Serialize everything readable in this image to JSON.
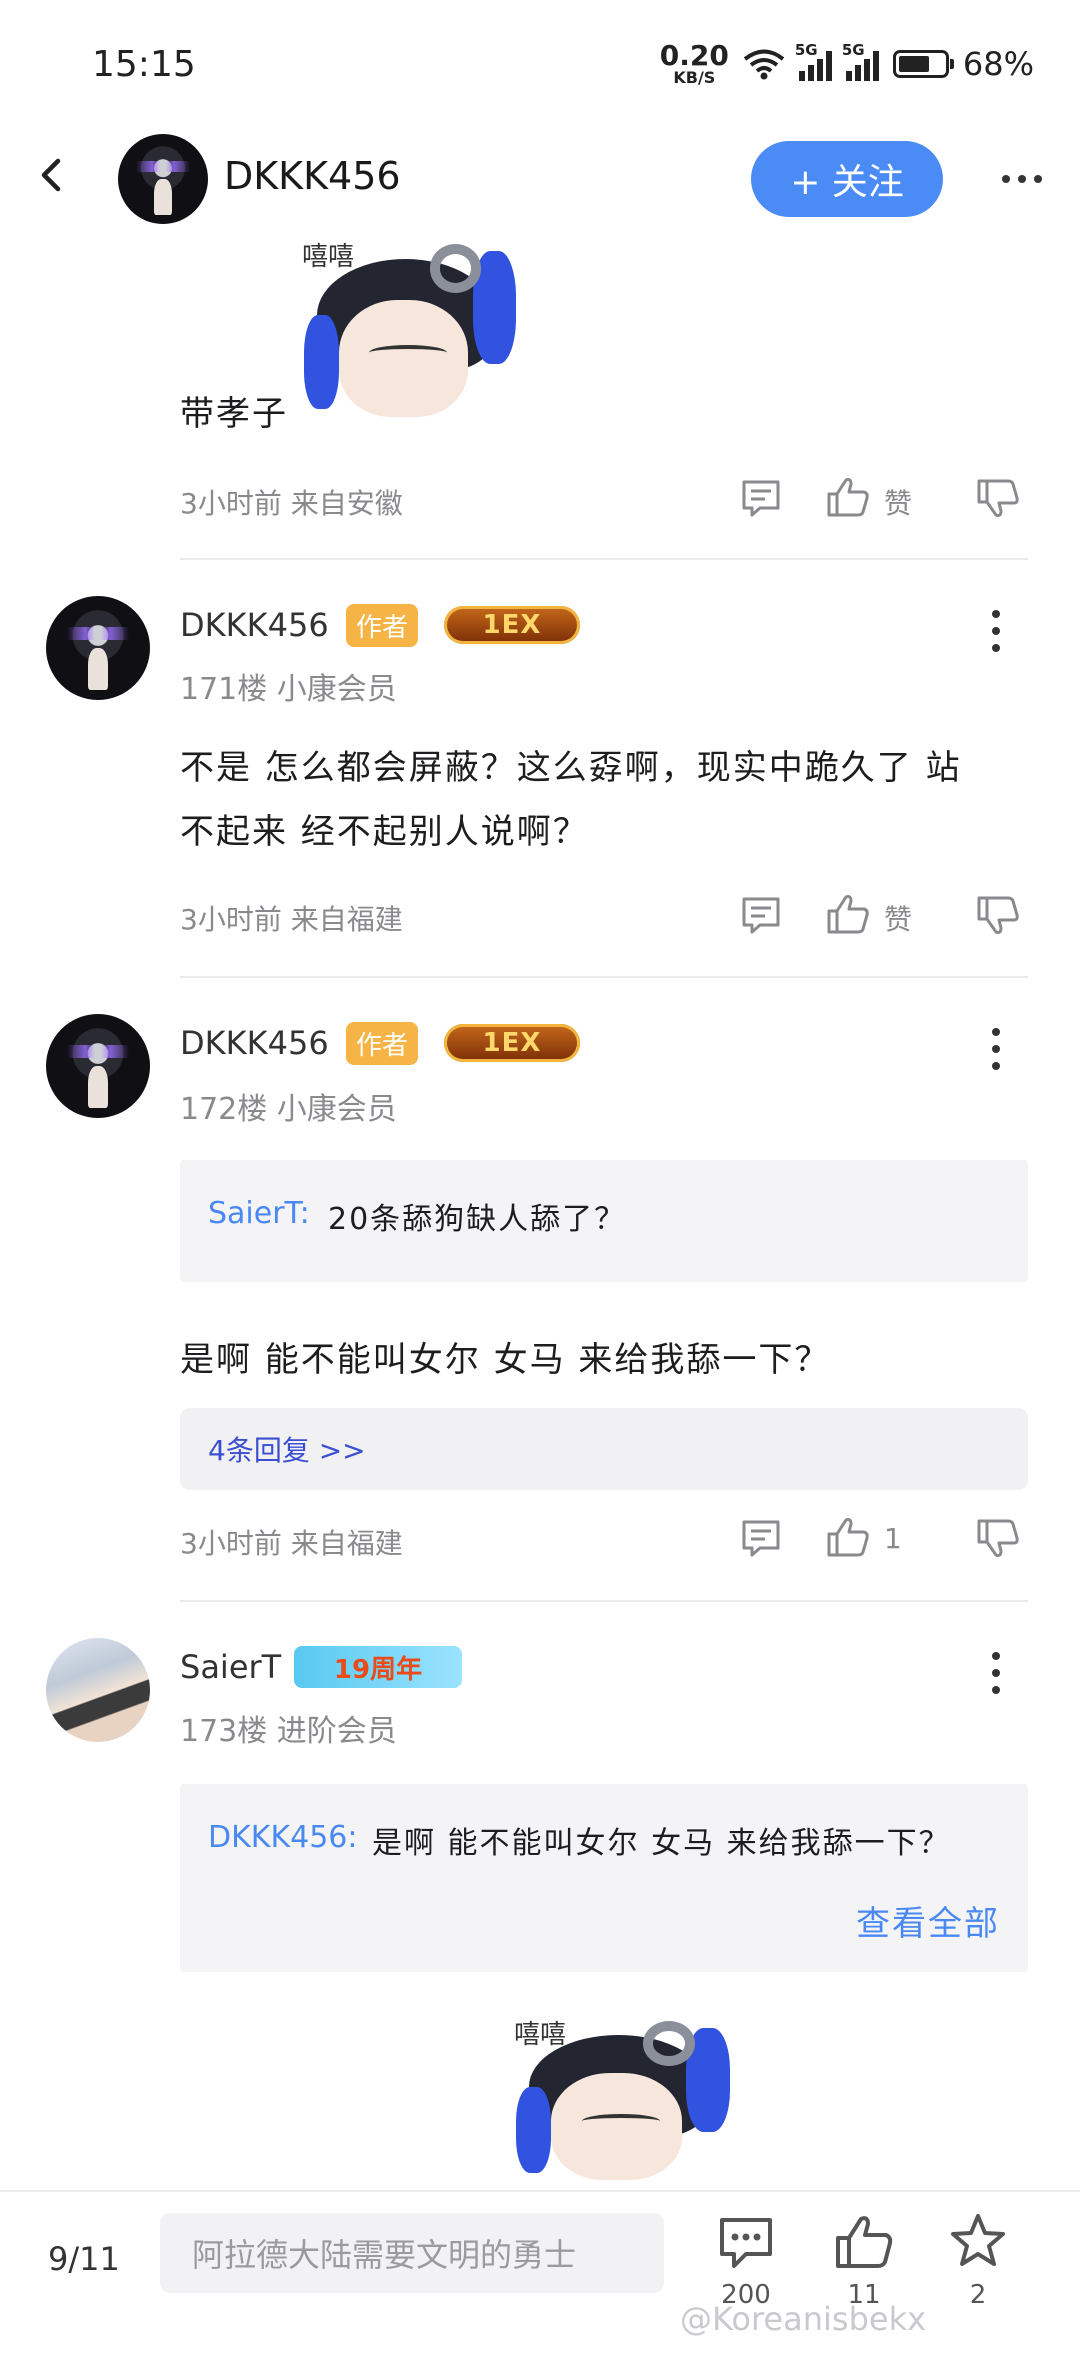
{
  "status_bar": {
    "time": "15:15",
    "net_speed_value": "0.20",
    "net_speed_unit": "KB/S",
    "signal1": "5G",
    "signal2": "5G",
    "battery_pct": "68%",
    "battery_level": 0.68
  },
  "header": {
    "username": "DKKK456",
    "follow_label": "+ 关注"
  },
  "posts": [
    {
      "text": "带孝子",
      "meta": "3小时前 来自安徽",
      "like_label": "赞"
    },
    {
      "username": "DKKK456",
      "author_badge": "作者",
      "level_badge": "1EX",
      "floor": "171楼 小康会员",
      "text_line1": "不是 怎么都会屏蔽？这么孬啊，现实中跪久了 站",
      "text_line2": "不起来 经不起别人说啊？",
      "meta": "3小时前 来自福建",
      "like_label": "赞"
    },
    {
      "username": "DKKK456",
      "author_badge": "作者",
      "level_badge": "1EX",
      "floor": "172楼 小康会员",
      "quote_user": "SaierT:",
      "quote_text": "20条舔狗缺人舔了？",
      "text": "是啊 能不能叫女尔 女马 来给我舔一下？",
      "replies_link": "4条回复 >>",
      "meta": "3小时前 来自福建",
      "like_label": "1"
    },
    {
      "username": "SaierT",
      "anniv_badge": "19周年",
      "floor": "173楼 进阶会员",
      "quote_user": "DKKK456:",
      "quote_text": "是啊 能不能叫女尔 女马 来给我舔一下？",
      "view_all": "查看全部",
      "sticker_text": "嘻嘻"
    }
  ],
  "sticker_text": "嘻嘻",
  "bottom_bar": {
    "page_indicator": "9/11",
    "input_placeholder": "阿拉德大陆需要文明的勇士",
    "comment_count": "200",
    "like_count": "11",
    "star_count": "2"
  },
  "watermark": "@Koreanisbekx",
  "accent_color": "#4b8bf5"
}
